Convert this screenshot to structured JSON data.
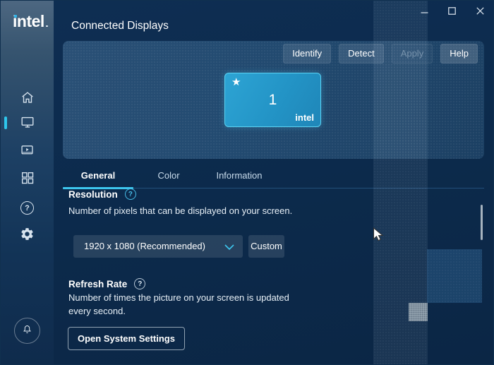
{
  "app": {
    "title": "Connected Displays"
  },
  "sidebar": {
    "logo": "intel",
    "help_glyph": "?",
    "items": [
      {
        "name": "home",
        "icon": "home-icon",
        "active": false
      },
      {
        "name": "displays",
        "icon": "display-icon",
        "active": true
      },
      {
        "name": "media",
        "icon": "video-play-icon",
        "active": false
      },
      {
        "name": "apps",
        "icon": "grid-icon",
        "active": false
      },
      {
        "name": "support",
        "icon": "question-circle-icon",
        "active": false
      },
      {
        "name": "settings",
        "icon": "gear-icon",
        "active": false
      }
    ],
    "notification_icon": "bell-icon"
  },
  "window_controls": [
    "minimize",
    "maximize",
    "close"
  ],
  "toolbar": {
    "identify_label": "Identify",
    "detect_label": "Detect",
    "apply_label": "Apply",
    "apply_enabled": false,
    "help_label": "Help"
  },
  "monitor_tile": {
    "star": "★",
    "number": "1",
    "brand": "intel"
  },
  "tabs": [
    {
      "label": "General",
      "active": true
    },
    {
      "label": "Color",
      "active": false
    },
    {
      "label": "Information",
      "active": false
    }
  ],
  "resolution": {
    "title": "Resolution",
    "help_glyph": "?",
    "description": "Number of pixels that can be displayed on your screen.",
    "selected_value": "1920 x 1080 (Recommended)",
    "custom_label": "Custom"
  },
  "refresh_rate": {
    "title": "Refresh Rate",
    "help_glyph": "?",
    "description": "Number of times the picture on your screen is updated every second.",
    "open_system_settings_label": "Open System Settings"
  },
  "colors": {
    "accent_cyan": "#3dc6ee",
    "tile_fill": "#2496c8",
    "tile_border": "#5ad2f2",
    "background": "#0c2949"
  }
}
